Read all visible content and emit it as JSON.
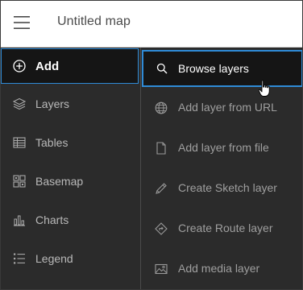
{
  "header": {
    "title": "Untitled map",
    "menu_icon": "hamburger-menu-icon"
  },
  "sidebar": {
    "add_label": "Add",
    "items": [
      {
        "label": "Layers",
        "icon": "layers-icon"
      },
      {
        "label": "Tables",
        "icon": "table-icon"
      },
      {
        "label": "Basemap",
        "icon": "basemap-icon"
      },
      {
        "label": "Charts",
        "icon": "chart-icon"
      },
      {
        "label": "Legend",
        "icon": "legend-icon"
      }
    ]
  },
  "add_menu": {
    "items": [
      {
        "label": "Browse layers",
        "icon": "search-icon",
        "selected": true
      },
      {
        "label": "Add layer from URL",
        "icon": "globe-icon"
      },
      {
        "label": "Add layer from file",
        "icon": "file-icon"
      },
      {
        "label": "Create Sketch layer",
        "icon": "pencil-icon"
      },
      {
        "label": "Create Route layer",
        "icon": "route-icon"
      },
      {
        "label": "Add media layer",
        "icon": "image-icon"
      }
    ]
  },
  "colors": {
    "accent": "#2f8bd7",
    "panel_bg": "#2b2b2b",
    "active_bg": "#151515",
    "header_bg": "#ffffff"
  }
}
